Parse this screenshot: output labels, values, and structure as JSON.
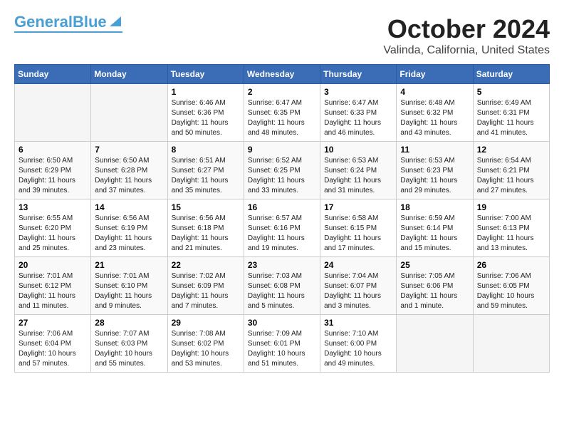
{
  "logo": {
    "text1": "General",
    "text2": "Blue"
  },
  "title": "October 2024",
  "location": "Valinda, California, United States",
  "days_of_week": [
    "Sunday",
    "Monday",
    "Tuesday",
    "Wednesday",
    "Thursday",
    "Friday",
    "Saturday"
  ],
  "weeks": [
    [
      {
        "day": "",
        "content": ""
      },
      {
        "day": "",
        "content": ""
      },
      {
        "day": "1",
        "sunrise": "6:46 AM",
        "sunset": "6:36 PM",
        "daylight": "11 hours and 50 minutes."
      },
      {
        "day": "2",
        "sunrise": "6:47 AM",
        "sunset": "6:35 PM",
        "daylight": "11 hours and 48 minutes."
      },
      {
        "day": "3",
        "sunrise": "6:47 AM",
        "sunset": "6:33 PM",
        "daylight": "11 hours and 46 minutes."
      },
      {
        "day": "4",
        "sunrise": "6:48 AM",
        "sunset": "6:32 PM",
        "daylight": "11 hours and 43 minutes."
      },
      {
        "day": "5",
        "sunrise": "6:49 AM",
        "sunset": "6:31 PM",
        "daylight": "11 hours and 41 minutes."
      }
    ],
    [
      {
        "day": "6",
        "sunrise": "6:50 AM",
        "sunset": "6:29 PM",
        "daylight": "11 hours and 39 minutes."
      },
      {
        "day": "7",
        "sunrise": "6:50 AM",
        "sunset": "6:28 PM",
        "daylight": "11 hours and 37 minutes."
      },
      {
        "day": "8",
        "sunrise": "6:51 AM",
        "sunset": "6:27 PM",
        "daylight": "11 hours and 35 minutes."
      },
      {
        "day": "9",
        "sunrise": "6:52 AM",
        "sunset": "6:25 PM",
        "daylight": "11 hours and 33 minutes."
      },
      {
        "day": "10",
        "sunrise": "6:53 AM",
        "sunset": "6:24 PM",
        "daylight": "11 hours and 31 minutes."
      },
      {
        "day": "11",
        "sunrise": "6:53 AM",
        "sunset": "6:23 PM",
        "daylight": "11 hours and 29 minutes."
      },
      {
        "day": "12",
        "sunrise": "6:54 AM",
        "sunset": "6:21 PM",
        "daylight": "11 hours and 27 minutes."
      }
    ],
    [
      {
        "day": "13",
        "sunrise": "6:55 AM",
        "sunset": "6:20 PM",
        "daylight": "11 hours and 25 minutes."
      },
      {
        "day": "14",
        "sunrise": "6:56 AM",
        "sunset": "6:19 PM",
        "daylight": "11 hours and 23 minutes."
      },
      {
        "day": "15",
        "sunrise": "6:56 AM",
        "sunset": "6:18 PM",
        "daylight": "11 hours and 21 minutes."
      },
      {
        "day": "16",
        "sunrise": "6:57 AM",
        "sunset": "6:16 PM",
        "daylight": "11 hours and 19 minutes."
      },
      {
        "day": "17",
        "sunrise": "6:58 AM",
        "sunset": "6:15 PM",
        "daylight": "11 hours and 17 minutes."
      },
      {
        "day": "18",
        "sunrise": "6:59 AM",
        "sunset": "6:14 PM",
        "daylight": "11 hours and 15 minutes."
      },
      {
        "day": "19",
        "sunrise": "7:00 AM",
        "sunset": "6:13 PM",
        "daylight": "11 hours and 13 minutes."
      }
    ],
    [
      {
        "day": "20",
        "sunrise": "7:01 AM",
        "sunset": "6:12 PM",
        "daylight": "11 hours and 11 minutes."
      },
      {
        "day": "21",
        "sunrise": "7:01 AM",
        "sunset": "6:10 PM",
        "daylight": "11 hours and 9 minutes."
      },
      {
        "day": "22",
        "sunrise": "7:02 AM",
        "sunset": "6:09 PM",
        "daylight": "11 hours and 7 minutes."
      },
      {
        "day": "23",
        "sunrise": "7:03 AM",
        "sunset": "6:08 PM",
        "daylight": "11 hours and 5 minutes."
      },
      {
        "day": "24",
        "sunrise": "7:04 AM",
        "sunset": "6:07 PM",
        "daylight": "11 hours and 3 minutes."
      },
      {
        "day": "25",
        "sunrise": "7:05 AM",
        "sunset": "6:06 PM",
        "daylight": "11 hours and 1 minute."
      },
      {
        "day": "26",
        "sunrise": "7:06 AM",
        "sunset": "6:05 PM",
        "daylight": "10 hours and 59 minutes."
      }
    ],
    [
      {
        "day": "27",
        "sunrise": "7:06 AM",
        "sunset": "6:04 PM",
        "daylight": "10 hours and 57 minutes."
      },
      {
        "day": "28",
        "sunrise": "7:07 AM",
        "sunset": "6:03 PM",
        "daylight": "10 hours and 55 minutes."
      },
      {
        "day": "29",
        "sunrise": "7:08 AM",
        "sunset": "6:02 PM",
        "daylight": "10 hours and 53 minutes."
      },
      {
        "day": "30",
        "sunrise": "7:09 AM",
        "sunset": "6:01 PM",
        "daylight": "10 hours and 51 minutes."
      },
      {
        "day": "31",
        "sunrise": "7:10 AM",
        "sunset": "6:00 PM",
        "daylight": "10 hours and 49 minutes."
      },
      {
        "day": "",
        "content": ""
      },
      {
        "day": "",
        "content": ""
      }
    ]
  ]
}
